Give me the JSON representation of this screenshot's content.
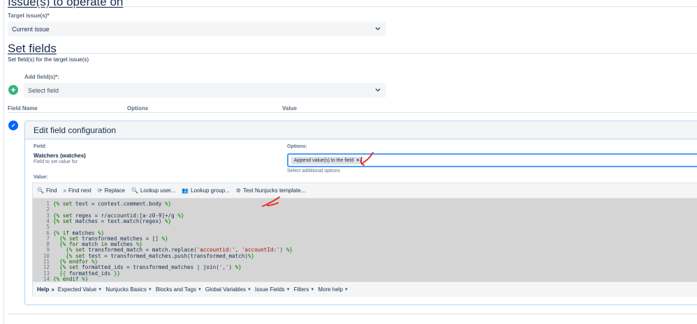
{
  "issue_section": {
    "title": "Issue(s) to operate on",
    "target_label": "Target issue(s)",
    "required_mark": "*",
    "target_value": "Current issue"
  },
  "set_fields_section": {
    "title": "Set fields",
    "description": "Set field(s) for the target issue(s)",
    "add_label": "Add field(s)",
    "required_mark": "*",
    "add_placeholder": "Select field",
    "columns": [
      "Field Name",
      "Options",
      "Value"
    ]
  },
  "edit_panel": {
    "title": "Edit field configuration",
    "field_label": "Field:",
    "field_name": "Watchers (watches)",
    "field_hint": "Field to set value for",
    "options_label": "Options:",
    "option_chip": "Append value(s) to the field",
    "option_chip_remove": "×",
    "options_hint": "Select additional options",
    "value_label": "Value:"
  },
  "toolbar": {
    "buttons": [
      {
        "icon": "search-icon",
        "glyph": "🔍",
        "label": "Find"
      },
      {
        "icon": "find-next-icon",
        "glyph": "»",
        "label": "Find next"
      },
      {
        "icon": "replace-icon",
        "glyph": "⟳",
        "label": "Replace"
      },
      {
        "icon": "user-lookup-icon",
        "glyph": "🔍",
        "label": "Lookup user..."
      },
      {
        "icon": "group-lookup-icon",
        "glyph": "👥",
        "label": "Lookup group..."
      },
      {
        "icon": "gear-icon",
        "glyph": "⚙",
        "label": "Test Nunjucks template..."
      }
    ]
  },
  "code_lines": [
    "{% set text = context.comment.body %}",
    "",
    "{% set regex = r/accountid:[a-z0-9]+/g %}",
    "{% set matches = text.match(regex) %}",
    "",
    "{% if matches %}",
    "  {% set transformed_matches = [] %}",
    "  {% for match in matches %}",
    "    {% set transformed_match = match.replace('accountid:', 'accountId:') %}",
    "    {% set test = transformed_matches.push(transformed_match)%}",
    "  {% endfor %}",
    "  {% set formatted_ids = transformed_matches | join(',') %}",
    "  {{ formatted_ids }}",
    "{% endif %}"
  ],
  "line_numbers": [
    "1",
    "2",
    "3",
    "4",
    "5",
    "6",
    "7",
    "8",
    "9",
    "10",
    "11",
    "12",
    "13",
    "14"
  ],
  "help_bar": {
    "help_label": "Help",
    "items": [
      "Expected Value",
      "Nunjucks Basics",
      "Blocks and Tags",
      "Global Variables",
      "Issue Fields",
      "Filters",
      "More help"
    ]
  },
  "colors": {
    "accent": "#0065ff",
    "add_button": "#36b37e",
    "annotation": "#e5332a"
  }
}
